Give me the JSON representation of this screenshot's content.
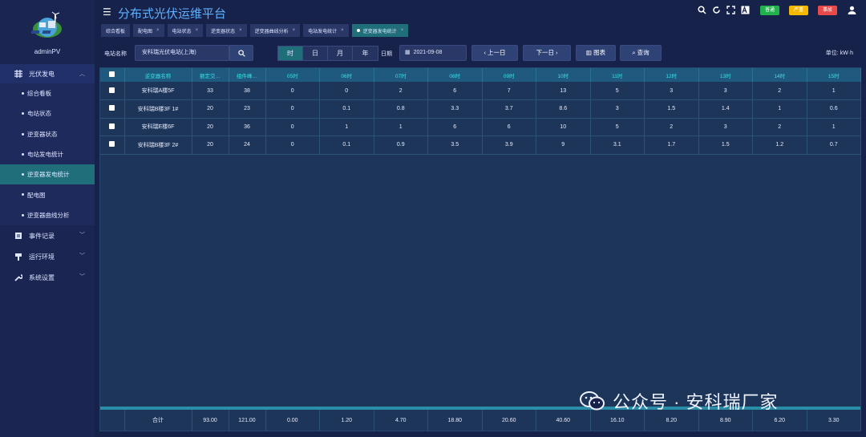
{
  "app": {
    "title": "分布式光伏运维平台",
    "username": "adminPV"
  },
  "header": {
    "badges": [
      {
        "label": "普通",
        "color": "#22b14c"
      },
      {
        "label": "严重",
        "color": "#f5b800"
      },
      {
        "label": "事故",
        "color": "#e84a4a"
      }
    ]
  },
  "sidebar": {
    "groups": [
      {
        "label": "光伏发电",
        "icon": "grid-icon"
      },
      {
        "label": "事件记录",
        "icon": "document-icon"
      },
      {
        "label": "运行环境",
        "icon": "environment-icon"
      },
      {
        "label": "系统设置",
        "icon": "wrench-icon"
      }
    ],
    "sub_items": [
      "综合看板",
      "电站状态",
      "逆变器状态",
      "电站发电统计",
      "逆变器发电统计",
      "配电图",
      "逆变器曲线分析"
    ]
  },
  "tabs": [
    "综合看板",
    "配电图",
    "电站状态",
    "逆变器状态",
    "逆变器曲线分析",
    "电站发电统计",
    "逆变器发电统计"
  ],
  "toolbar": {
    "station_label": "电站名称",
    "station_value": "安科瑞光伏电站(上海)",
    "seg": [
      "时",
      "日",
      "月",
      "年"
    ],
    "date_label": "日期",
    "date_value": "2021-09-08",
    "prev_label": "上一日",
    "next_label": "下一日",
    "chart_label": "图表",
    "query_label": "查询",
    "unit": "单位:  kW·h"
  },
  "table": {
    "headers": [
      "逆变器名称",
      "额定交…",
      "组件峰…",
      "05时",
      "06时",
      "07时",
      "08时",
      "09时",
      "10时",
      "11时",
      "12时",
      "13时",
      "14时",
      "15时"
    ],
    "rows": [
      [
        "安科瑞A楼5F",
        "33",
        "38",
        "0",
        "0",
        "2",
        "6",
        "7",
        "13",
        "5",
        "3",
        "3",
        "2",
        "1"
      ],
      [
        "安科瑞B楼3F 1#",
        "20",
        "23",
        "0",
        "0.1",
        "0.8",
        "3.3",
        "3.7",
        "8.6",
        "3",
        "1.5",
        "1.4",
        "1",
        "0.6"
      ],
      [
        "安科瑞E楼6F",
        "20",
        "36",
        "0",
        "1",
        "1",
        "6",
        "6",
        "10",
        "5",
        "2",
        "3",
        "2",
        "1"
      ],
      [
        "安科瑞B楼3F 2#",
        "20",
        "24",
        "0",
        "0.1",
        "0.9",
        "3.5",
        "3.9",
        "9",
        "3.1",
        "1.7",
        "1.5",
        "1.2",
        "0.7"
      ]
    ],
    "footer": [
      "合计",
      "93.00",
      "121.00",
      "0.00",
      "1.20",
      "4.70",
      "18.80",
      "20.60",
      "40.60",
      "16.10",
      "8.20",
      "8.90",
      "6.20",
      "3.30"
    ]
  },
  "watermark": {
    "text": "公众号 · 安科瑞厂家"
  }
}
